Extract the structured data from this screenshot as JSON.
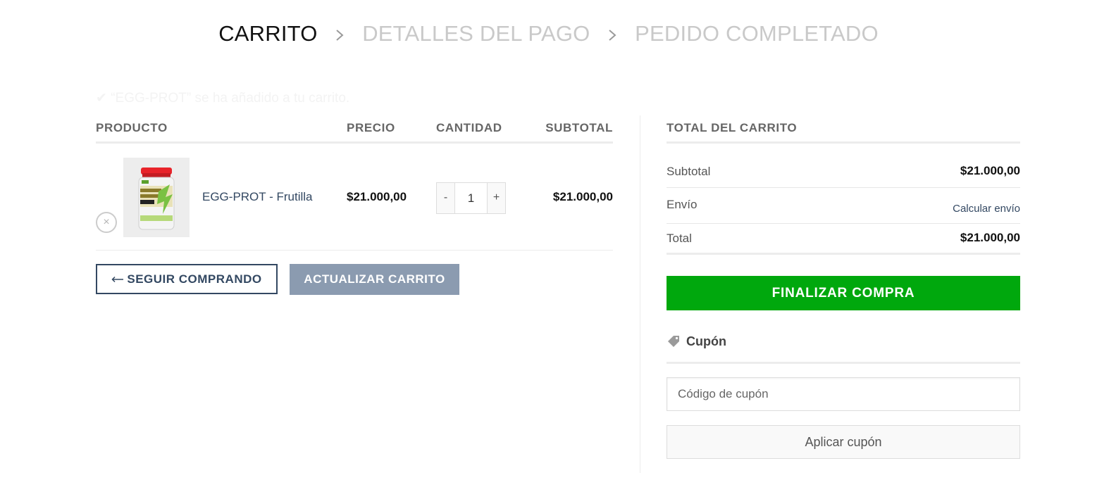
{
  "steps": {
    "items": [
      {
        "label": "CARRITO",
        "state": "active"
      },
      {
        "label": "DETALLES DEL PAGO",
        "state": "inactive"
      },
      {
        "label": "PEDIDO COMPLETADO",
        "state": "inactive"
      }
    ],
    "separator_icon": "chevron-right-icon"
  },
  "notice": {
    "text": "✔ “EGG-PROT” se ha añadido a tu carrito."
  },
  "cart": {
    "headers": {
      "product": "PRODUCTO",
      "price": "PRECIO",
      "quantity": "CANTIDAD",
      "subtotal": "SUBTOTAL"
    },
    "items": [
      {
        "remove_symbol": "×",
        "name": "EGG-PROT - Frutilla",
        "price": "$21.000,00",
        "quantity": "1",
        "decrement": "-",
        "increment": "+",
        "subtotal": "$21.000,00"
      }
    ],
    "continue_button": "SEGUIR COMPRANDO",
    "update_button": "ACTUALIZAR CARRITO"
  },
  "totals": {
    "title": "TOTAL DEL CARRITO",
    "subtotal_label": "Subtotal",
    "subtotal_value": "$21.000,00",
    "shipping_label": "Envío",
    "shipping_link": "Calcular envío",
    "total_label": "Total",
    "total_value": "$21.000,00",
    "checkout_button": "FINALIZAR COMPRA"
  },
  "coupon": {
    "title": "Cupón",
    "icon": "tag-icon",
    "input_placeholder": "Código de cupón",
    "apply_button": "Aplicar cupón"
  },
  "colors": {
    "checkout_green": "#00a80d",
    "link_blue": "#334862",
    "update_button_gray": "#8b9bb0"
  }
}
